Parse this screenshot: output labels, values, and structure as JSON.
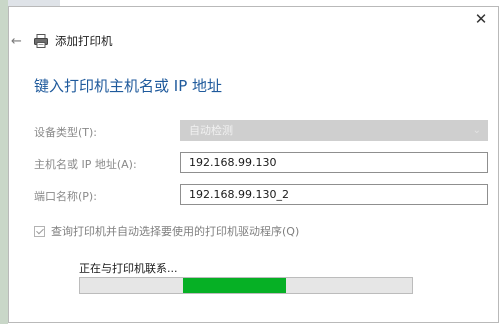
{
  "window": {
    "title": "添加打印机",
    "close_icon": "close-icon",
    "back_icon": "back-arrow-icon"
  },
  "heading": "键入打印机主机名或 IP 地址",
  "form": {
    "device_type": {
      "label": "设备类型(T):",
      "value": "自动检测",
      "disabled": true
    },
    "hostname": {
      "label": "主机名或 IP 地址(A):",
      "value": "192.168.99.130"
    },
    "port_name": {
      "label": "端口名称(P):",
      "value": "192.168.99.130_2"
    }
  },
  "auto_driver_checkbox": {
    "label": "查询打印机并自动选择要使用的打印机驱动程序(Q)",
    "checked": true,
    "disabled": true
  },
  "status": {
    "text": "正在与打印机联系...",
    "progress": {
      "start": 0.31,
      "end": 0.62
    }
  },
  "colors": {
    "heading": "#1f5a9c",
    "progress_fill": "#06b025",
    "disabled_field": "#cfcfcf"
  }
}
